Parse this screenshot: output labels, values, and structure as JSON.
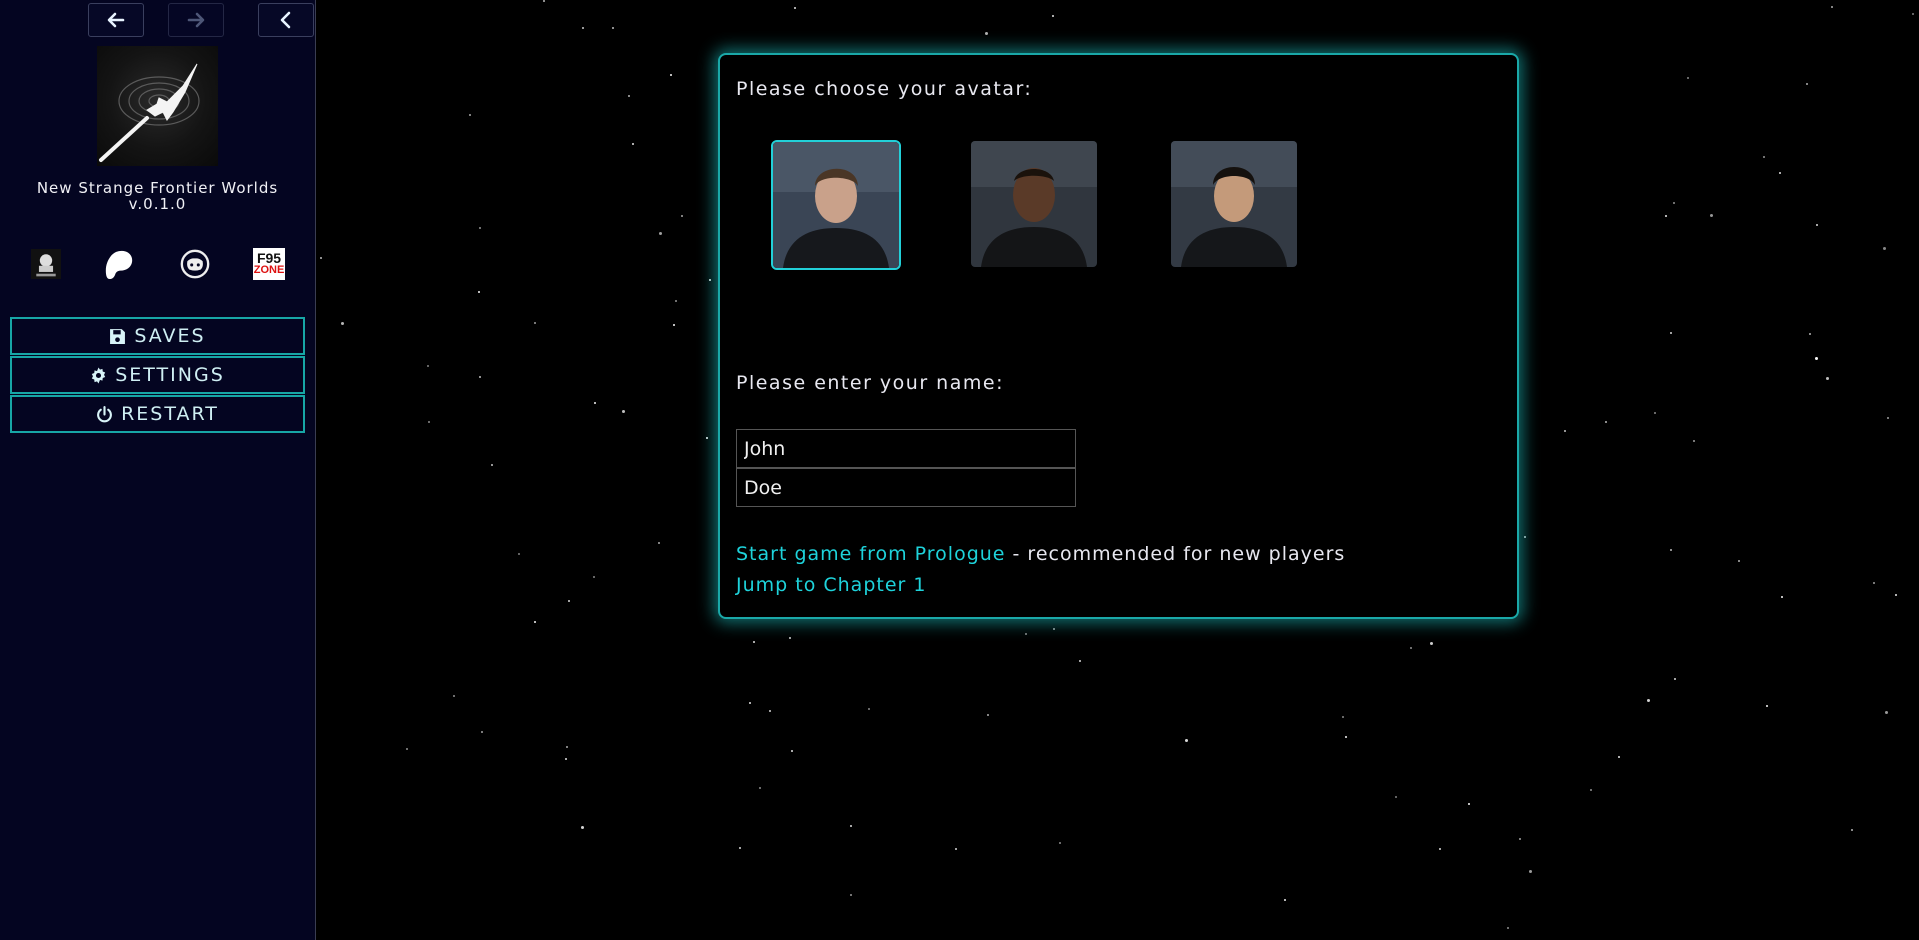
{
  "sidebar": {
    "game_title": "New Strange Frontier Worlds",
    "version": "v.0.1.0",
    "social_icons": [
      "kemono-icon",
      "patreon-icon",
      "discord-icon",
      "f95zone-icon"
    ],
    "social_f95_text": "F95",
    "social_f95_sub": "ZONE",
    "menu": {
      "saves": "SAVES",
      "settings": "SETTINGS",
      "restart": "RESTART"
    }
  },
  "panel": {
    "avatar_prompt": "Please choose your avatar:",
    "avatars": [
      "avatar-1",
      "avatar-2",
      "avatar-3"
    ],
    "selected_avatar": 1,
    "name_prompt": "Please enter your name:",
    "first_name": "John",
    "last_name": "Doe",
    "start_link": "Start game from Prologue",
    "start_suffix": " - recommended for new players",
    "jump_link": "Jump to Chapter 1"
  },
  "colors": {
    "accent": "#1ed3db",
    "border": "#17a6a6",
    "sidebar_bg": "#040521",
    "background": "#000000"
  }
}
